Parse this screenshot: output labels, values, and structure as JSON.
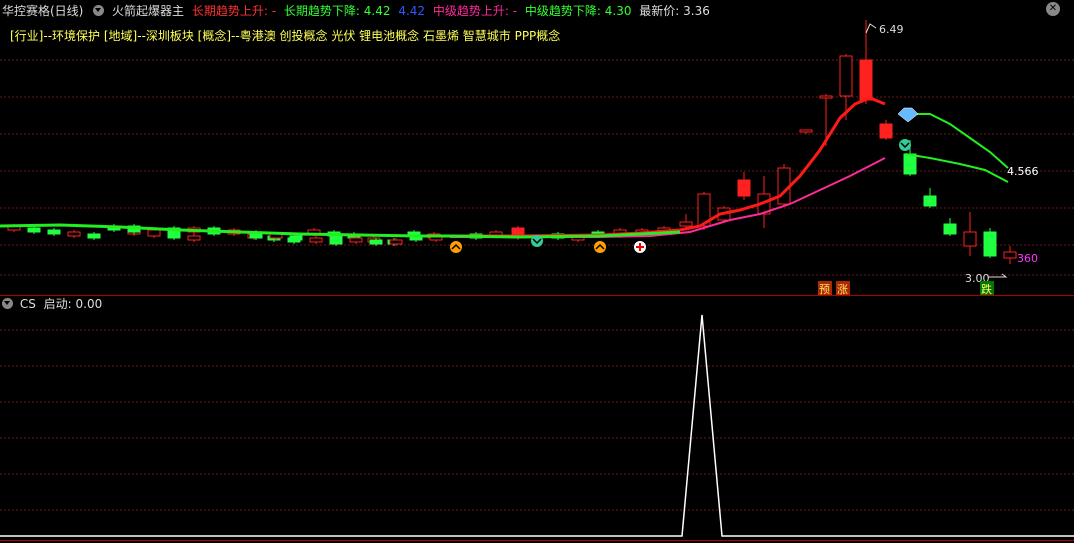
{
  "header": {
    "stock_title": "华控赛格(日线)",
    "indicator_name": "火箭起爆器主",
    "long_up_label": "长期趋势上升: -",
    "long_down_label": "长期趋势下降: 4.42",
    "blue_value": "4.42",
    "mid_up_label": "中级趋势上升: -",
    "mid_down_label": "中级趋势下降: 4.30",
    "last_price_label": "最新价: 3.36"
  },
  "concepts": "[行业]--环境保护 [地域]--深圳板块 [概念]--粤港澳 创投概念 光伏 锂电池概念 石墨烯 智慧城市 PPP概念",
  "main_chart": {
    "high_label": "6.49",
    "low_label": "3.00",
    "value_label_green": "4.566",
    "value_label_magenta": "360",
    "badge_yu": "预",
    "badge_zhang": "涨",
    "badge_die": "跌"
  },
  "sub_chart": {
    "name": "CS",
    "start_label": "启动: 0.00"
  },
  "colors": {
    "up": "#ff2020",
    "down": "#20ff40",
    "long_line": "#ff1a1a",
    "mid_line": "#ff2a9a",
    "green_line": "#22ee22",
    "grid": "#6a1a1a"
  }
}
